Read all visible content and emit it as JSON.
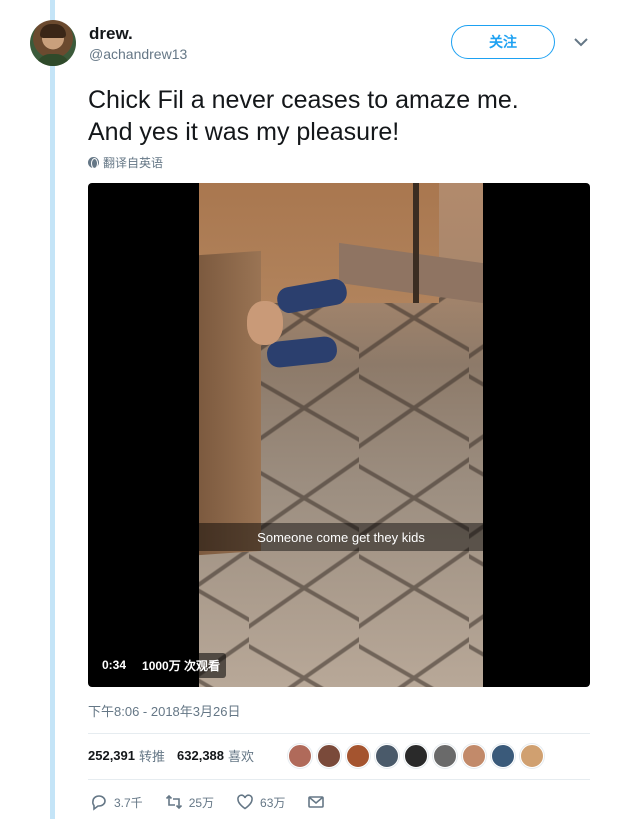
{
  "user": {
    "display_name": "drew.",
    "handle": "@achandrew13",
    "avatar_icon": "profile-photo"
  },
  "follow_label": "关注",
  "tweet": {
    "lines": [
      "Chick Fil a never ceases to amaze me.",
      "And yes it was my pleasure!"
    ]
  },
  "translate_label": "翻译自英语",
  "video": {
    "caption": "Someone come get they kids",
    "duration": "0:34",
    "views": "1000万 次观看"
  },
  "timestamp": "下午8:06 - 2018年3月26日",
  "stats": {
    "retweets_count": "252,391",
    "retweets_label": "转推",
    "likes_count": "632,388",
    "likes_label": "喜欢"
  },
  "likers": [
    {
      "color": "#b06a5a"
    },
    {
      "color": "#7a4a3a"
    },
    {
      "color": "#a4542f"
    },
    {
      "color": "#4a5a6a"
    },
    {
      "color": "#2a2a2a"
    },
    {
      "color": "#6a6a6a"
    },
    {
      "color": "#c28a6a"
    },
    {
      "color": "#3a5a7a"
    },
    {
      "color": "#d0a070"
    }
  ],
  "actions": {
    "replies": "3.7千",
    "retweets": "25万",
    "likes": "63万"
  },
  "colors": {
    "accent": "#1da1f2",
    "thread_line": "#c4e4f7",
    "secondary_text": "#657786"
  }
}
